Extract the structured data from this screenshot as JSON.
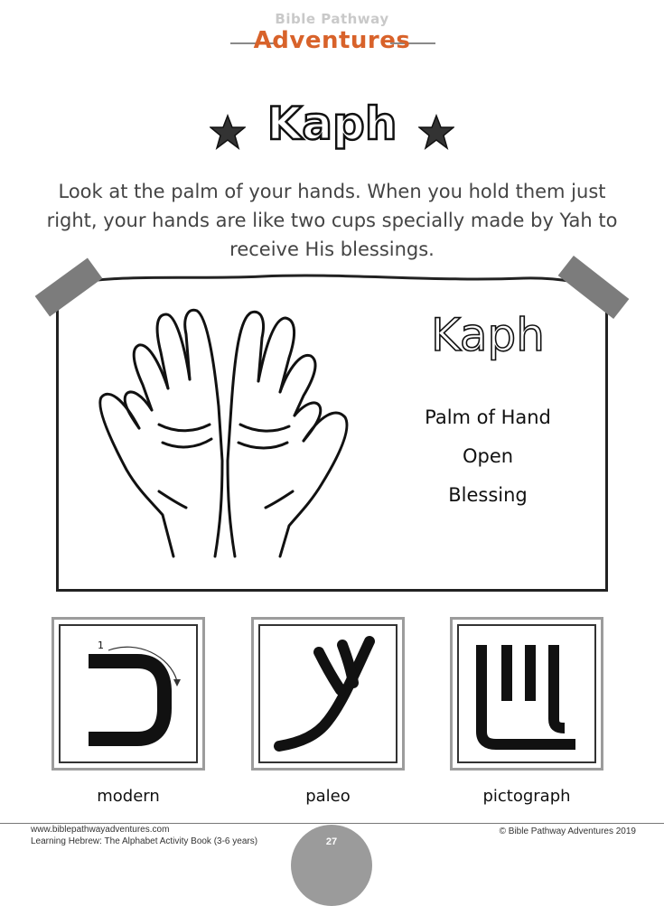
{
  "header": {
    "logo_top": "Bible Pathway",
    "logo_main": "Adventures"
  },
  "title": "Kaph",
  "intro": "Look at the palm of your hands. When you hold them just right, your hands are like two cups specially made by Yah to receive His blessings.",
  "poster": {
    "word": "Kaph",
    "meanings": [
      "Palm of Hand",
      "Open",
      "Blessing"
    ]
  },
  "letters": [
    {
      "label": "modern",
      "stroke_number": "1"
    },
    {
      "label": "paleo"
    },
    {
      "label": "pictograph"
    }
  ],
  "footer": {
    "website": "www.biblepathwayadventures.com",
    "book": "Learning Hebrew: The Alphabet Activity Book (3-6 years)",
    "copyright": "© Bible Pathway Adventures 2019",
    "page_number": "27"
  },
  "colors": {
    "brand_orange": "#d8622a",
    "tape_gray": "#7c7c7c",
    "footer_circle": "#9b9b9b"
  }
}
